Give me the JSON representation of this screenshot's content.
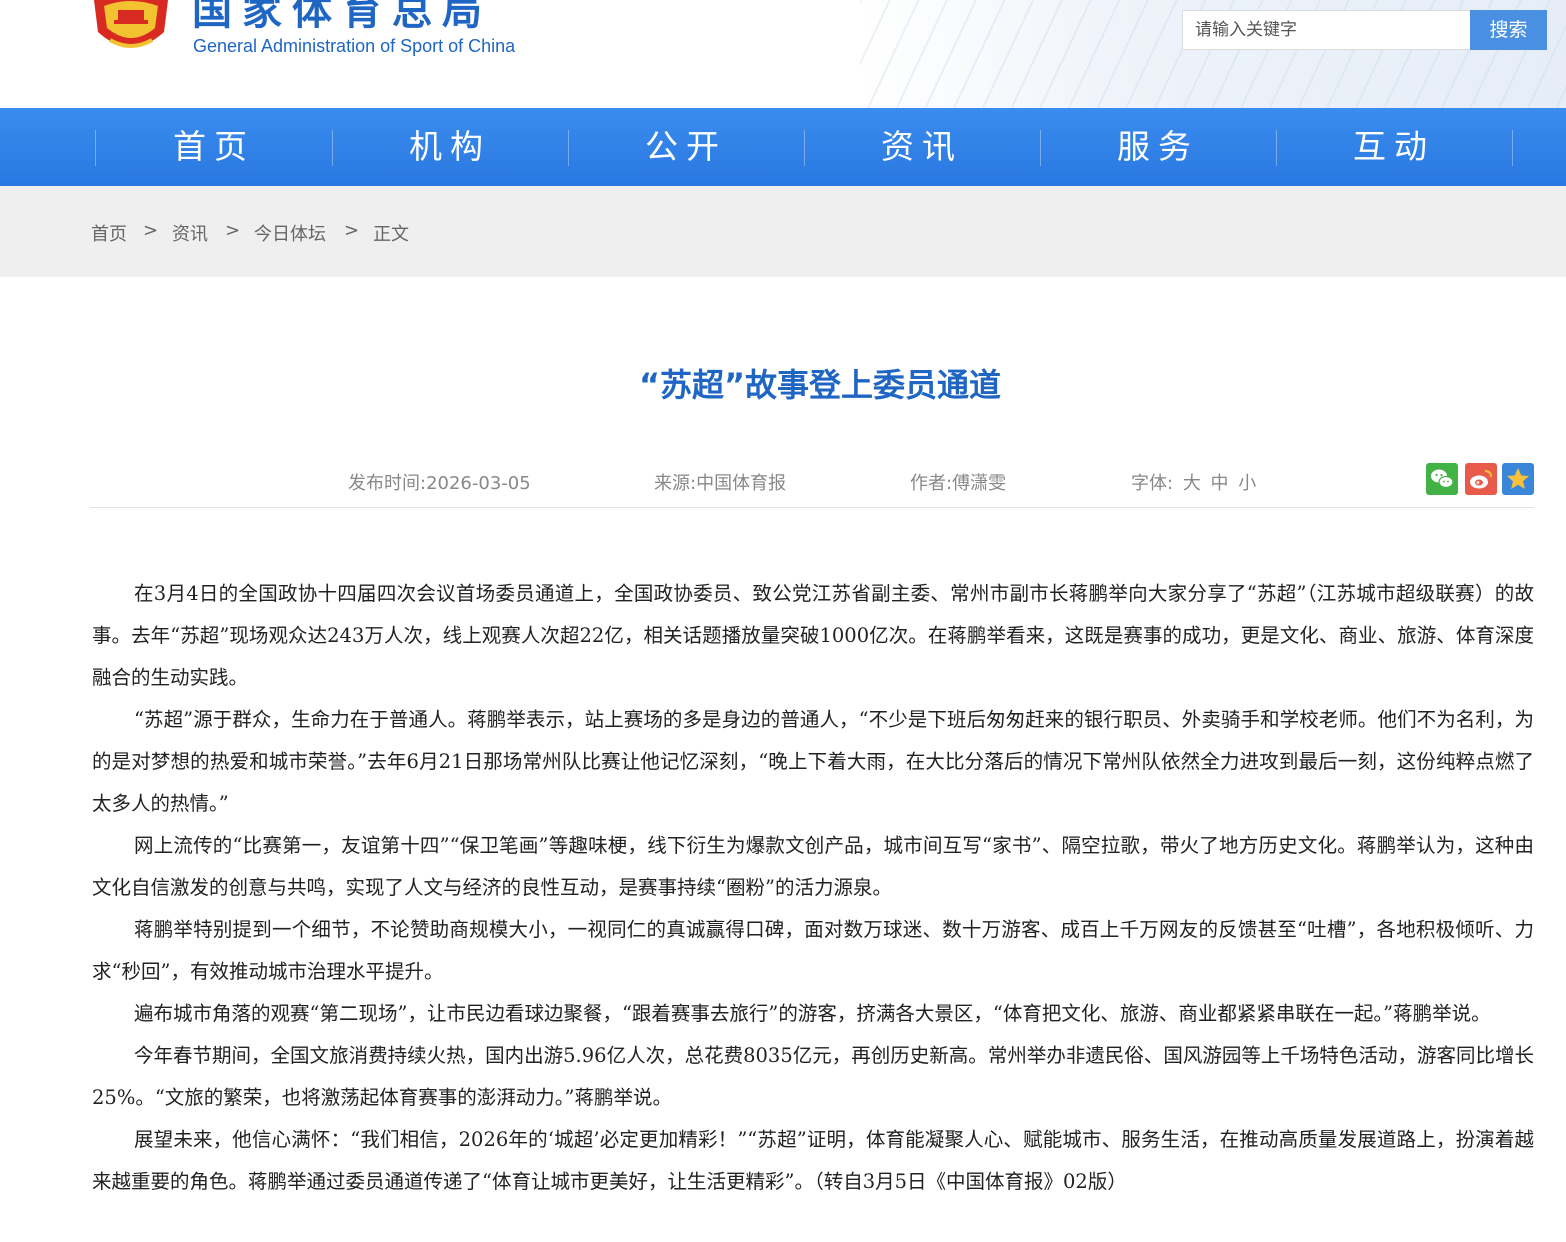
{
  "header": {
    "site_name_cn": "国家体育总局",
    "site_name_en": "General Administration of Sport of China",
    "search": {
      "placeholder": "请输入关键字",
      "button_label": "搜索"
    }
  },
  "nav": {
    "items": [
      "首页",
      "机构",
      "公开",
      "资讯",
      "服务",
      "互动"
    ]
  },
  "breadcrumb": {
    "items": [
      "首页",
      "资讯",
      "今日体坛",
      "正文"
    ],
    "separator": ">"
  },
  "article": {
    "title": "“苏超”故事登上委员通道",
    "meta": {
      "publish_label": "发布时间:",
      "publish_date": "2026-03-05",
      "source_label": "来源:",
      "source": "中国体育报",
      "author_label": "作者:",
      "author": "傅潇雯",
      "font_label": "字体:",
      "font_sizes": [
        "大",
        "中",
        "小"
      ]
    },
    "share_icons": [
      "wechat-share-icon",
      "weibo-share-icon",
      "favorite-star-icon"
    ],
    "paragraphs": [
      "在3月4日的全国政协十四届四次会议首场委员通道上，全国政协委员、致公党江苏省副主委、常州市副市长蒋鹏举向大家分享了“苏超”（江苏城市超级联赛）的故事。去年“苏超”现场观众达243万人次，线上观赛人次超22亿，相关话题播放量突破1000亿次。在蒋鹏举看来，这既是赛事的成功，更是文化、商业、旅游、体育深度融合的生动实践。",
      "“苏超”源于群众，生命力在于普通人。蒋鹏举表示，站上赛场的多是身边的普通人，“不少是下班后匆匆赶来的银行职员、外卖骑手和学校老师。他们不为名利，为的是对梦想的热爱和城市荣誉。”去年6月21日那场常州队比赛让他记忆深刻，“晚上下着大雨，在大比分落后的情况下常州队依然全力进攻到最后一刻，这份纯粹点燃了太多人的热情。”",
      "网上流传的“比赛第一，友谊第十四”“保卫笔画”等趣味梗，线下衍生为爆款文创产品，城市间互写“家书”、隔空拉歌，带火了地方历史文化。蒋鹏举认为，这种由文化自信激发的创意与共鸣，实现了人文与经济的良性互动，是赛事持续“圈粉”的活力源泉。",
      "蒋鹏举特别提到一个细节，不论赞助商规模大小，一视同仁的真诚赢得口碑，面对数万球迷、数十万游客、成百上千万网友的反馈甚至“吐槽”，各地积极倾听、力求“秒回”，有效推动城市治理水平提升。",
      "遍布城市角落的观赛“第二现场”，让市民边看球边聚餐，“跟着赛事去旅行”的游客，挤满各大景区，“体育把文化、旅游、商业都紧紧串联在一起。”蒋鹏举说。",
      "今年春节期间，全国文旅消费持续火热，国内出游5.96亿人次，总花费8035亿元，再创历史新高。常州举办非遗民俗、国风游园等上千场特色活动，游客同比增长25%。“文旅的繁荣，也将激荡起体育赛事的澎湃动力。”蒋鹏举说。",
      "展望未来，他信心满怀：“我们相信，2026年的‘城超’必定更加精彩！”“苏超”证明，体育能凝聚人心、赋能城市、服务生活，在推动高质量发展道路上，扮演着越来越重要的角色。蒋鹏举通过委员通道传递了“体育让城市更美好，让生活更精彩”。（转自3月5日《中国体育报》02版）"
    ]
  },
  "colors": {
    "brand_blue": "#1f66c4",
    "nav_blue": "#2a78e2",
    "search_button": "#4a90e2"
  }
}
